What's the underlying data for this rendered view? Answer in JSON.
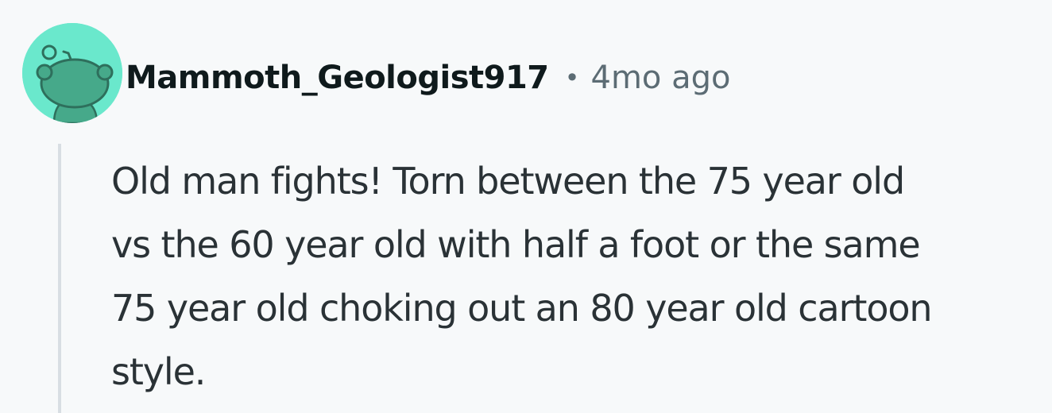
{
  "comment": {
    "author": "Mammoth_Geologist917",
    "separator": "•",
    "timestamp": "4mo ago",
    "body_lines": [
      "Old man fights! Torn between the 75 year old",
      "vs the 60 year old with half a foot or the same",
      "75 year old choking out an 80 year old cartoon",
      "style."
    ]
  },
  "colors": {
    "avatar_background": "#6ae8cc",
    "avatar_figure": "#46a98a",
    "page_background": "#f7f9fa",
    "username": "#0f1a1c",
    "meta_text": "#5c6c74",
    "body_text": "#2a3236",
    "thread_line": "#d8dee3"
  },
  "icons": {
    "avatar": "reddit-snoo-avatar-icon"
  }
}
